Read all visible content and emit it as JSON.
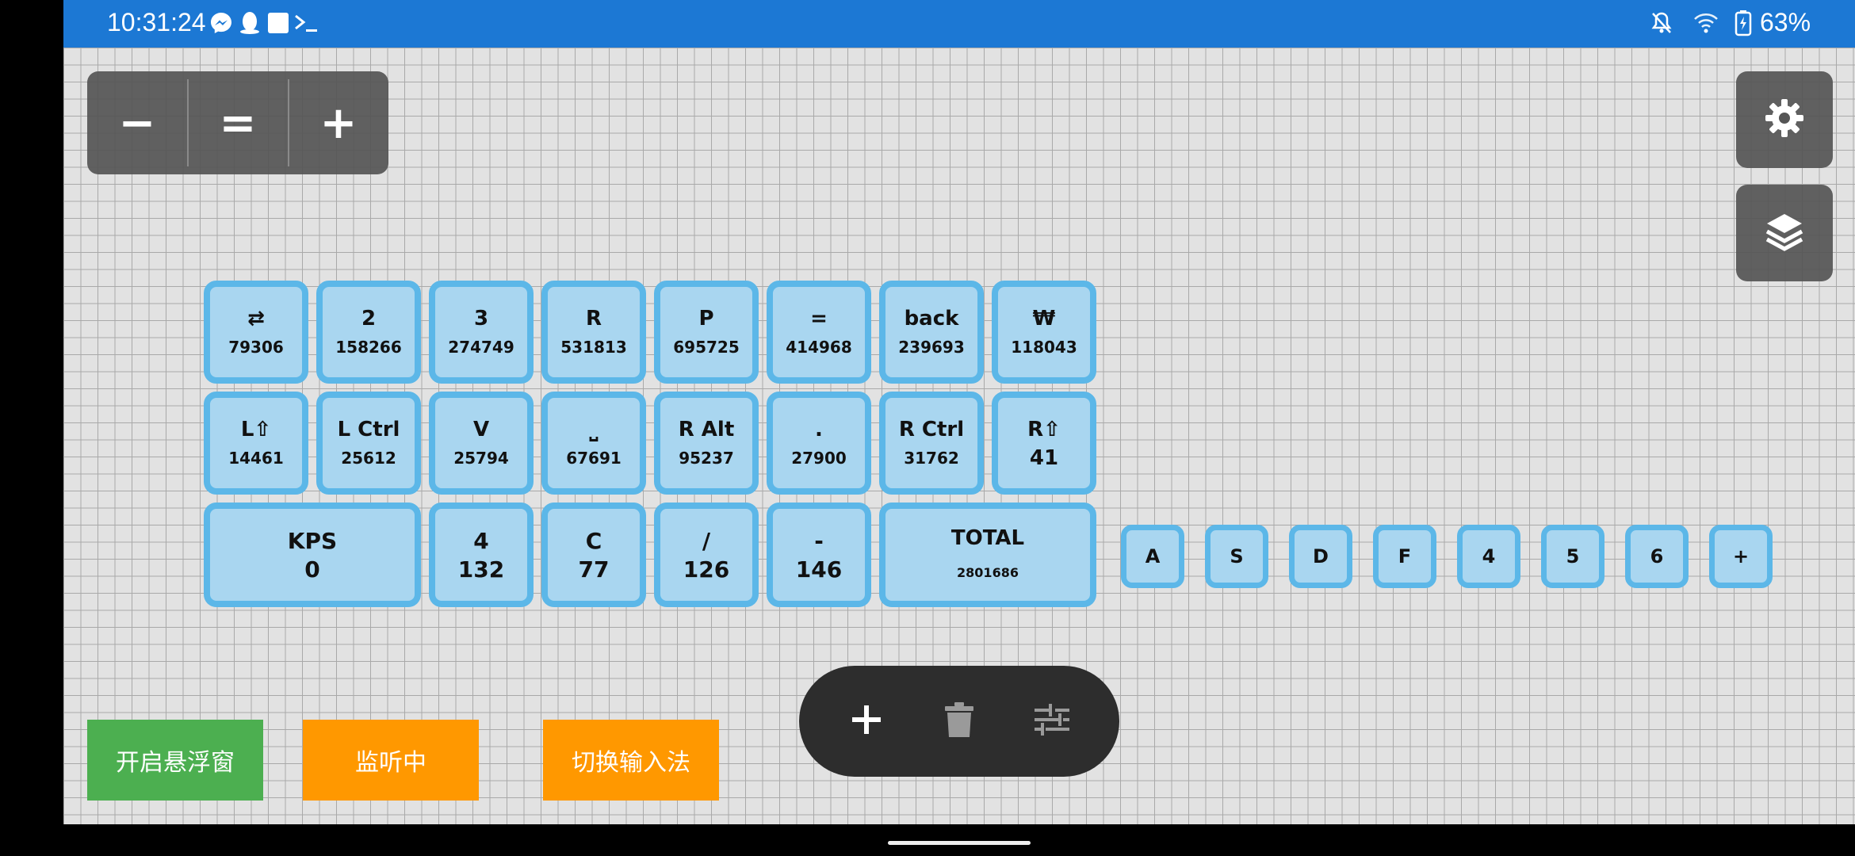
{
  "status_bar": {
    "time": "10:31:24",
    "battery": "63%",
    "left_icons": [
      "messenger-icon",
      "qq-icon",
      "square-icon",
      "terminal-icon"
    ],
    "right_icons": [
      "bell-off-icon",
      "wifi-icon",
      "battery-charging-icon"
    ]
  },
  "zoom_panel": {
    "minus": "−",
    "reset": "=",
    "plus": "+"
  },
  "keys": [
    {
      "label": "⇄",
      "count": "79306"
    },
    {
      "label": "2",
      "count": "158266"
    },
    {
      "label": "3",
      "count": "274749"
    },
    {
      "label": "R",
      "count": "531813"
    },
    {
      "label": "P",
      "count": "695725"
    },
    {
      "label": "=",
      "count": "414968"
    },
    {
      "label": "back",
      "count": "239693"
    },
    {
      "label": "₩",
      "count": "118043"
    },
    {
      "label": "L⇧",
      "count": "14461"
    },
    {
      "label": "L Ctrl",
      "count": "25612"
    },
    {
      "label": "V",
      "count": "25794"
    },
    {
      "label": "⎵",
      "count": "67691"
    },
    {
      "label": "R Alt",
      "count": "95237"
    },
    {
      "label": ".",
      "count": "27900"
    },
    {
      "label": "R Ctrl",
      "count": "31762"
    },
    {
      "label": "R⇧",
      "count": "41"
    },
    {
      "label": "KPS",
      "count": "0"
    },
    {
      "label": "4",
      "count": "132"
    },
    {
      "label": "C",
      "count": "77"
    },
    {
      "label": "/",
      "count": "126"
    },
    {
      "label": "-",
      "count": "146"
    },
    {
      "label": "TOTAL",
      "count": "2801686"
    }
  ],
  "small_keys": [
    "A",
    "S",
    "D",
    "F",
    "4",
    "5",
    "6",
    "+"
  ],
  "toolbar": {
    "add_icon": "plus-icon",
    "delete_icon": "trash-icon",
    "settings_icon": "sliders-icon"
  },
  "side_buttons": [
    "gear-icon",
    "layers-icon"
  ],
  "actions": {
    "float_window": "开启悬浮窗",
    "listening": "监听中",
    "switch_ime": "切换输入法"
  },
  "colors": {
    "status_bar": "#1c78d4",
    "key_fill": "#a9d6f0",
    "key_border": "#5cb7e8",
    "float_button": "#4caf50",
    "listen_button": "#ff9800",
    "switch_button": "#ff9800",
    "toolbar": "#2d2d2d",
    "panel": "#555555"
  }
}
